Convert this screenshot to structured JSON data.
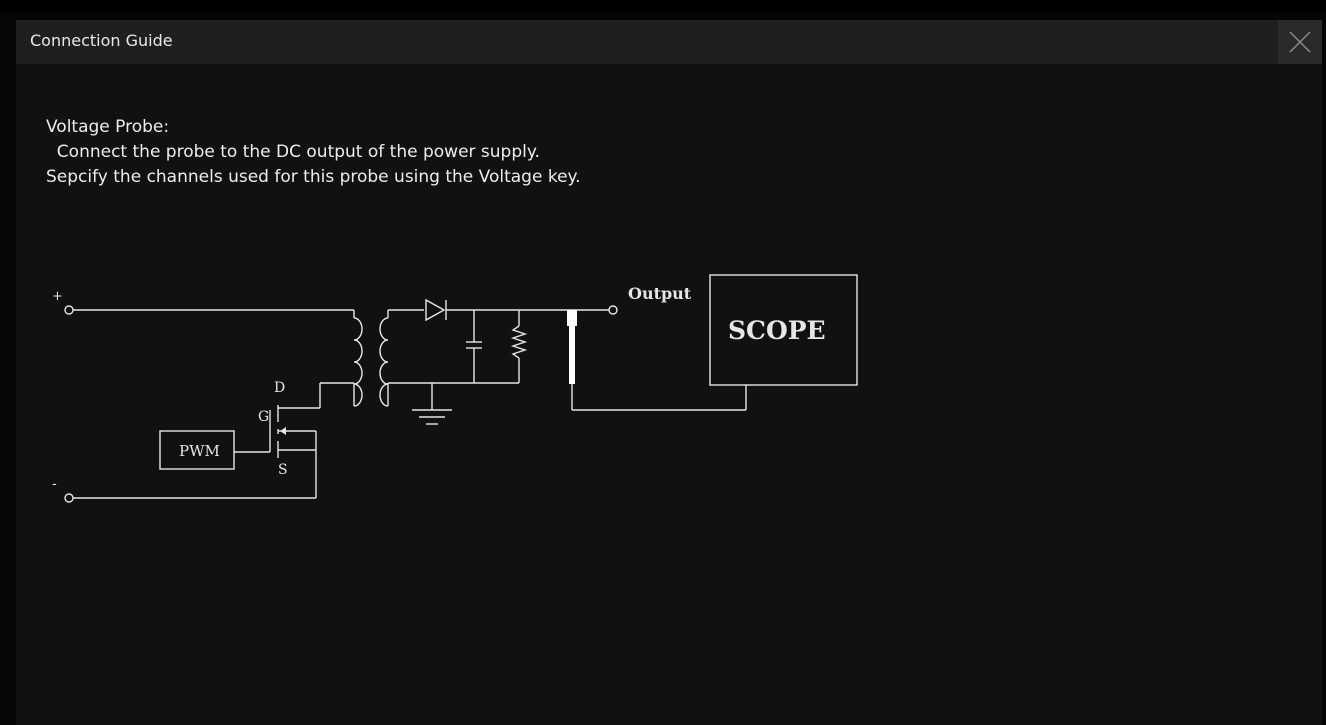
{
  "dialog": {
    "title": "Connection Guide",
    "close_icon": "close-icon"
  },
  "guide": {
    "heading": "Voltage Probe:",
    "line1": "  Connect the probe to the DC output of the power supply.",
    "line2": "Sepcify the channels used for this probe using the Voltage key."
  },
  "diagram": {
    "plus_label": "+",
    "minus_label": "-",
    "output_label": "Output",
    "scope_label": "SCOPE",
    "pwm_label": "PWM",
    "drain_label": "D",
    "gate_label": "G",
    "source_label": "S"
  },
  "colors": {
    "background": "#111111",
    "titlebar": "#1f1f1f",
    "line": "#e6e6e6"
  }
}
